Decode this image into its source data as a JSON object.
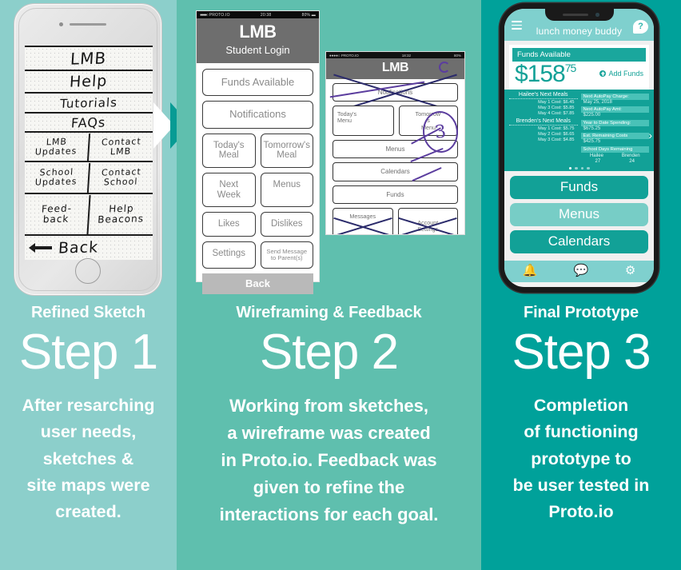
{
  "theme": {
    "col1_bg": "#8ccfcb",
    "col2_bg": "#5fbfae",
    "col3_bg": "#00a19a",
    "accent_dark_teal": "#12a197",
    "accent_light_teal": "#7fd0ce",
    "ink_purple": "#5b3d9e",
    "text_on_color": "#ffffff"
  },
  "columns": [
    {
      "id": "step-1",
      "kicker": "Refined Sketch",
      "step": "Step 1",
      "body": "After resarching\nuser needs,\nsketches &\nsite maps were\ncreated."
    },
    {
      "id": "step-2",
      "kicker": "Wireframing & Feedback",
      "step": "Step 2",
      "body": "Working from sketches,\na wireframe was created\nin Proto.io. Feedback was\ngiven to refine the\ninteractions for each goal."
    },
    {
      "id": "step-3",
      "kicker": "Final Prototype",
      "step": "Step 3",
      "body": "Completion\nof functioning\nprototype to\nbe user tested in\nProto.io"
    }
  ],
  "sketch_phone": {
    "rows": [
      {
        "type": "single",
        "label": "LMB"
      },
      {
        "type": "single",
        "label": "Help"
      },
      {
        "type": "single",
        "label": "Tutorials"
      },
      {
        "type": "single",
        "label": "FAQs"
      },
      {
        "type": "pair",
        "left": "LMB\nUpdates",
        "right": "Contact\nLMB"
      },
      {
        "type": "pair",
        "left": "School\nUpdates",
        "right": "Contact\nSchool"
      },
      {
        "type": "pair",
        "left": "Feed-\nback",
        "right": "Help\nBeacons"
      },
      {
        "type": "back",
        "label": "Back",
        "icon": "back-arrow-icon"
      }
    ]
  },
  "wireframe_phone": {
    "status": {
      "carrier": "PROTO.IO",
      "time": "20:38",
      "battery": "80%"
    },
    "logo": "LMB",
    "subtitle": "Student Login",
    "buttons": [
      {
        "label": "Funds Available",
        "span": "full"
      },
      {
        "label": "Notifications",
        "span": "full"
      }
    ],
    "pairs": [
      {
        "left": "Today's\nMeal",
        "right": "Tomorrow's\nMeal",
        "small": false
      },
      {
        "left": "Next\nWeek",
        "right": "Menus",
        "small": false
      },
      {
        "left": "Likes",
        "right": "Dislikes",
        "small": false
      },
      {
        "left": "Settings",
        "right": "Send Message\nto Parent(s)",
        "small": true
      }
    ],
    "back_label": "Back"
  },
  "wireframe_overlay": {
    "status": {
      "carrier": "PROTO.IO",
      "time": "18:32",
      "battery": "80%"
    },
    "logo": "LMB",
    "struck_top": "Notifications",
    "pair": {
      "left": "Today's\nMenu",
      "right": "Tomorrow'\ns\nMenu"
    },
    "list": [
      "Menus",
      "Calendars",
      "Funds"
    ],
    "struck_pair": {
      "left": "Messages",
      "right": "Account\nSettings"
    },
    "annotation_number": "3"
  },
  "prototype_phone": {
    "app_title": "lunch money buddy",
    "menu_icon": "hamburger-icon",
    "help_icon": "help-bubble-icon",
    "funds_header": "Funds Available",
    "amount_main": "$158",
    "amount_cents": "75",
    "add_funds": "Add Funds",
    "add_funds_icon": "plus-circle-icon",
    "meal_groups": [
      {
        "title": "Hailee's Next Meals",
        "rows": [
          "May 1  Cost: $6.45",
          "May 3  Cost: $5.85",
          "May 4  Cost: $7.85"
        ]
      },
      {
        "title": "Brenden's Next Meals",
        "rows": [
          "May 1  Cost: $5.75",
          "May 2  Cost: $6.65",
          "May 3  Cost: $4.85"
        ]
      }
    ],
    "info_rows": [
      {
        "label": "Next AutoPay Charge:",
        "value": "May 25, 2018"
      },
      {
        "label": "Next AutoPay Amt:",
        "value": "$225.00"
      },
      {
        "label": "Year to Date Spending:",
        "value": "$675.25"
      },
      {
        "label": "Est. Remaining Costs",
        "value": "$425.75"
      }
    ],
    "days_label": "School Days Remaining",
    "days": [
      {
        "name": "Hailee",
        "value": "27"
      },
      {
        "name": "Brenden",
        "value": "24"
      }
    ],
    "carousel_dots": 4,
    "carousel_active": 0,
    "next_arrow_icon": "chevron-right-icon",
    "nav_buttons": [
      {
        "label": "Funds",
        "style": "dark"
      },
      {
        "label": "Menus",
        "style": "light"
      },
      {
        "label": "Calendars",
        "style": "dark"
      }
    ],
    "footer_icons": [
      {
        "name": "bell-icon",
        "glyph": "🔔"
      },
      {
        "name": "chat-icon",
        "glyph": "💬"
      },
      {
        "name": "gear-icon",
        "glyph": "⚙"
      }
    ]
  }
}
